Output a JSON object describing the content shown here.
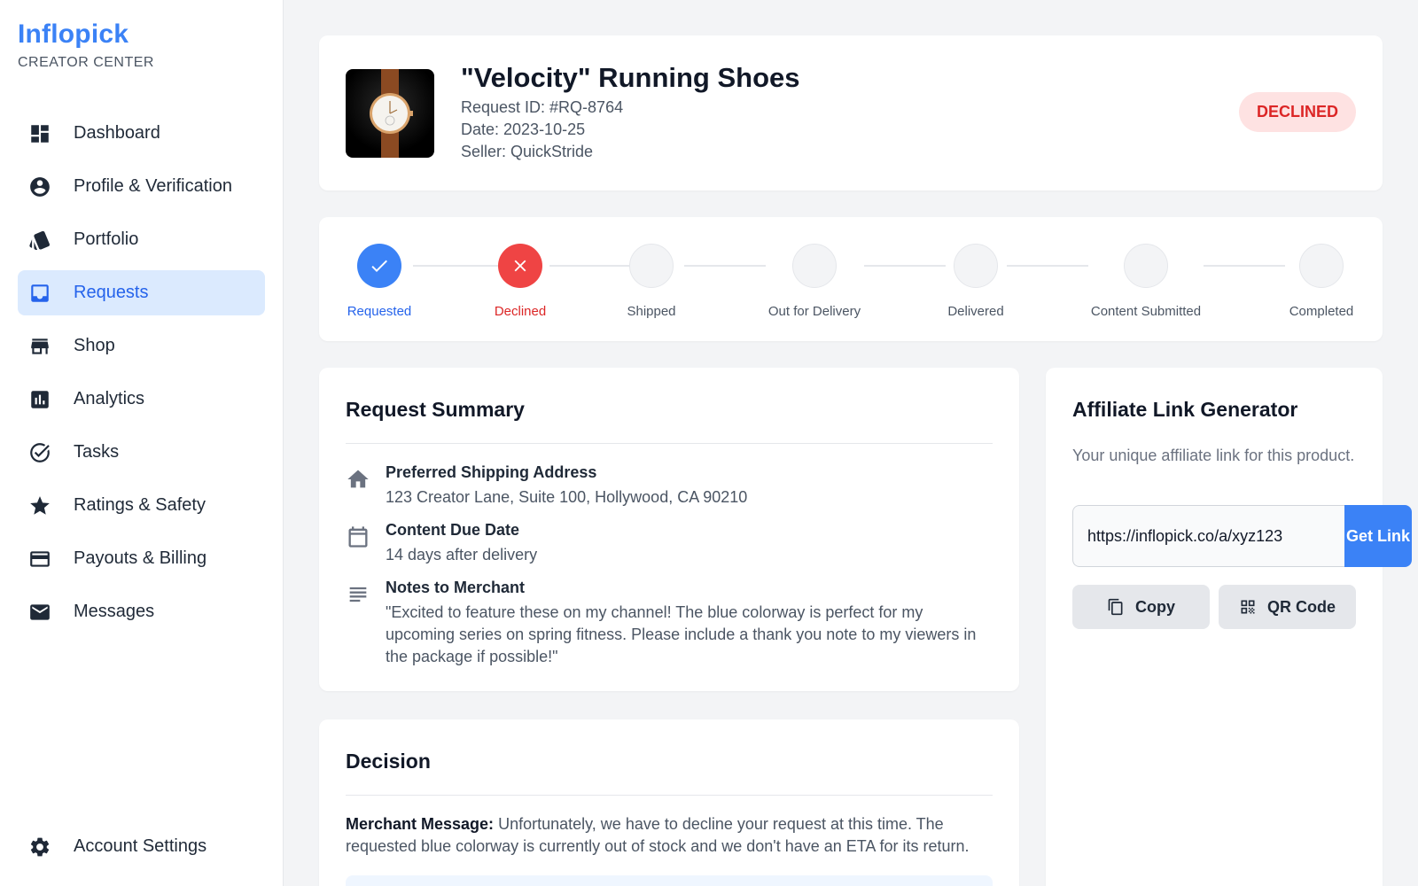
{
  "brand": {
    "name": "Inflopick",
    "subtitle": "CREATOR CENTER"
  },
  "sidebar": {
    "items": [
      {
        "label": "Dashboard",
        "icon": "dashboard-icon"
      },
      {
        "label": "Profile & Verification",
        "icon": "account-circle-icon"
      },
      {
        "label": "Portfolio",
        "icon": "portfolio-icon"
      },
      {
        "label": "Requests",
        "icon": "inbox-icon",
        "active": true
      },
      {
        "label": "Shop",
        "icon": "storefront-icon"
      },
      {
        "label": "Analytics",
        "icon": "analytics-icon"
      },
      {
        "label": "Tasks",
        "icon": "check-circle-icon"
      },
      {
        "label": "Ratings & Safety",
        "icon": "star-icon"
      },
      {
        "label": "Payouts & Billing",
        "icon": "credit-card-icon"
      },
      {
        "label": "Messages",
        "icon": "mail-icon"
      }
    ],
    "bottom": {
      "label": "Account Settings",
      "icon": "gear-icon"
    }
  },
  "product": {
    "title": "\"Velocity\" Running Shoes",
    "request_id": "Request ID: #RQ-8764",
    "date": "Date: 2023-10-25",
    "seller": "Seller: QuickStride",
    "status": "DECLINED",
    "image_icon": "product-watch-image"
  },
  "progress": {
    "steps": [
      {
        "label": "Requested",
        "state": "done"
      },
      {
        "label": "Declined",
        "state": "declined"
      },
      {
        "label": "Shipped",
        "state": "pending"
      },
      {
        "label": "Out for Delivery",
        "state": "pending"
      },
      {
        "label": "Delivered",
        "state": "pending"
      },
      {
        "label": "Content Submitted",
        "state": "pending"
      },
      {
        "label": "Completed",
        "state": "pending"
      }
    ]
  },
  "summary": {
    "title": "Request Summary",
    "shipping_label": "Preferred Shipping Address",
    "shipping_value": "123 Creator Lane, Suite 100, Hollywood, CA 90210",
    "due_label": "Content Due Date",
    "due_value": "14 days after delivery",
    "notes_label": "Notes to Merchant",
    "notes_value": "\"Excited to feature these on my channel! The blue colorway is perfect for my upcoming series on spring fitness. Please include a thank you note to my viewers in the package if possible!\""
  },
  "decision": {
    "title": "Decision",
    "message_label": "Merchant Message:",
    "message": "Unfortunately, we have to decline your request at this time. The requested blue colorway is currently out of stock and we don't have an ETA for its return."
  },
  "affiliate": {
    "title": "Affiliate Link Generator",
    "description": "Your unique affiliate link for this product.",
    "link": "https://inflopick.co/a/xyz123",
    "get_link": "Get Link",
    "copy": "Copy",
    "qr": "QR Code"
  },
  "colors": {
    "accent": "#3b82f6",
    "danger": "#ef4444",
    "active_bg": "#dbeafe"
  }
}
